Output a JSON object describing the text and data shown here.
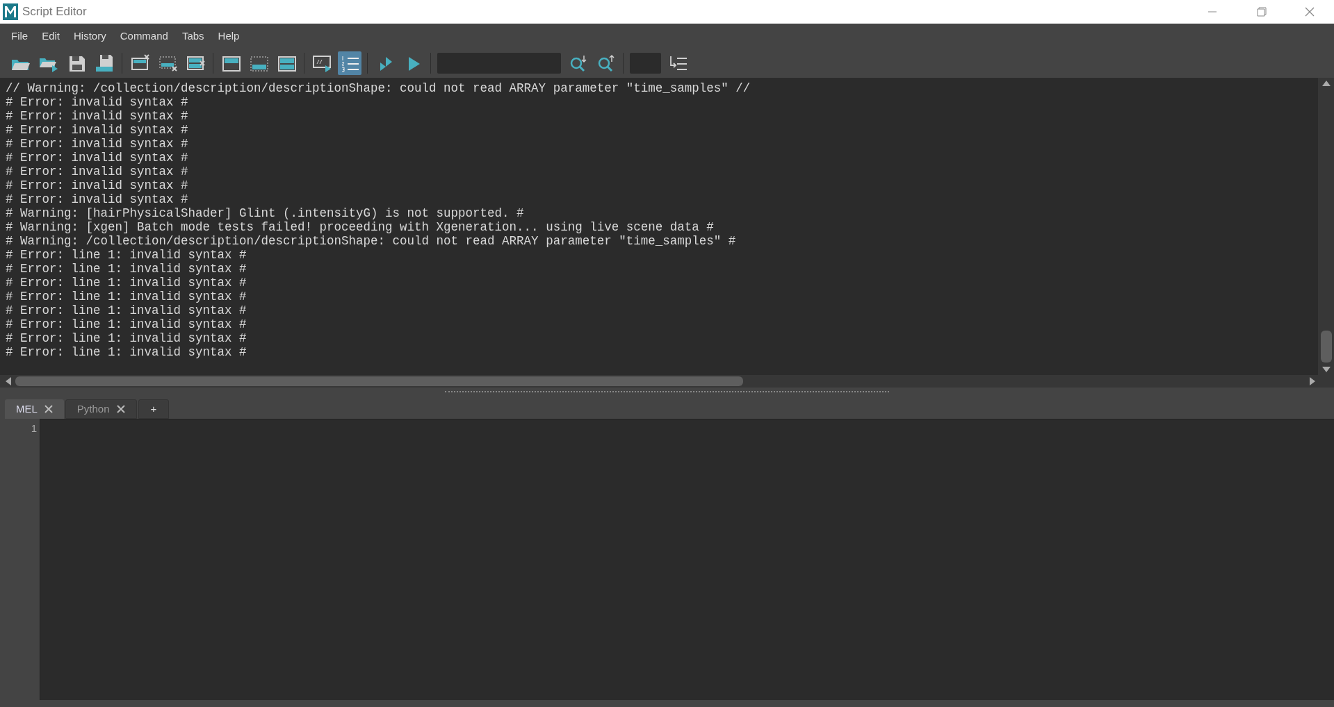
{
  "window": {
    "title": "Script Editor"
  },
  "menu": [
    "File",
    "Edit",
    "History",
    "Command",
    "Tabs",
    "Help"
  ],
  "toolbar": [
    {
      "kind": "open",
      "on": false
    },
    {
      "kind": "source",
      "on": false
    },
    {
      "kind": "save",
      "on": false
    },
    {
      "kind": "shelf",
      "on": false
    },
    {
      "kind": "sep"
    },
    {
      "kind": "clear-history",
      "on": false
    },
    {
      "kind": "clear-input",
      "on": false
    },
    {
      "kind": "clear-all",
      "on": false
    },
    {
      "kind": "sep"
    },
    {
      "kind": "show-history",
      "on": false
    },
    {
      "kind": "show-input",
      "on": false
    },
    {
      "kind": "show-both",
      "on": false
    },
    {
      "kind": "sep"
    },
    {
      "kind": "echo",
      "on": false
    },
    {
      "kind": "line-numbers",
      "on": true
    },
    {
      "kind": "sep"
    },
    {
      "kind": "run-all",
      "on": false
    },
    {
      "kind": "run",
      "on": false
    },
    {
      "kind": "sep"
    },
    {
      "kind": "search-field"
    },
    {
      "kind": "search-down",
      "on": false
    },
    {
      "kind": "search-up",
      "on": false
    },
    {
      "kind": "sep"
    },
    {
      "kind": "line-field"
    },
    {
      "kind": "goto-line",
      "on": false
    }
  ],
  "output": [
    "// Warning: /collection/description/descriptionShape: could not read ARRAY parameter \"time_samples\" //",
    "# Error: invalid syntax #",
    "# Error: invalid syntax #",
    "# Error: invalid syntax #",
    "# Error: invalid syntax #",
    "# Error: invalid syntax #",
    "# Error: invalid syntax #",
    "# Error: invalid syntax #",
    "# Error: invalid syntax #",
    "# Warning: [hairPhysicalShader] Glint (.intensityG) is not supported. #",
    "# Warning: [xgen] Batch mode tests failed! proceeding with Xgeneration... using live scene data #",
    "# Warning: /collection/description/descriptionShape: could not read ARRAY parameter \"time_samples\" #",
    "# Error: line 1: invalid syntax #",
    "# Error: line 1: invalid syntax #",
    "# Error: line 1: invalid syntax #",
    "# Error: line 1: invalid syntax #",
    "# Error: line 1: invalid syntax #",
    "# Error: line 1: invalid syntax #",
    "# Error: line 1: invalid syntax #",
    "# Error: line 1: invalid syntax #"
  ],
  "tabs": [
    {
      "label": "MEL",
      "selected": true
    },
    {
      "label": "Python",
      "selected": false
    }
  ],
  "add_tab": "+",
  "editor": {
    "line_numbers": [
      "1"
    ]
  }
}
